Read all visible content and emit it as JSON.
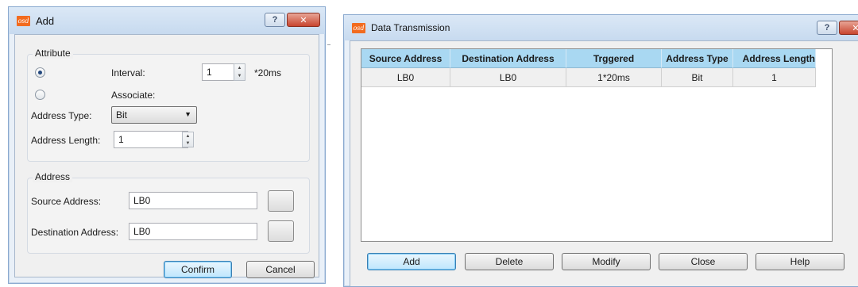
{
  "add_dialog": {
    "title": "Add",
    "help_glyph": "?",
    "close_glyph": "✕",
    "attribute_group": {
      "title": "Attribute",
      "interval_label": "Interval:",
      "interval_value": "1",
      "interval_unit": "*20ms",
      "associate_label": "Associate:",
      "address_type_label": "Address Type:",
      "address_type_value": "Bit",
      "address_length_label": "Address Length:",
      "address_length_value": "1"
    },
    "address_group": {
      "title": "Address",
      "source_label": "Source Address:",
      "source_value": "LB0",
      "destination_label": "Destination Address:",
      "destination_value": "LB0"
    },
    "confirm_label": "Confirm",
    "cancel_label": "Cancel"
  },
  "data_dialog": {
    "title": "Data Transmission",
    "help_glyph": "?",
    "close_glyph": "✕",
    "table": {
      "headers": [
        "Source Address",
        "Destination Address",
        "Trggered",
        "Address Type",
        "Address Length"
      ],
      "rows": [
        [
          "LB0",
          "LB0",
          "1*20ms",
          "Bit",
          "1"
        ]
      ]
    },
    "buttons": {
      "add": "Add",
      "delete": "Delete",
      "modify": "Modify",
      "close": "Close",
      "help": "Help"
    }
  },
  "colors": {
    "title_bar": "#c7daef",
    "close_button": "#c8452f",
    "table_header": "#a9d8f2",
    "primary_button": "#bee6fd"
  }
}
